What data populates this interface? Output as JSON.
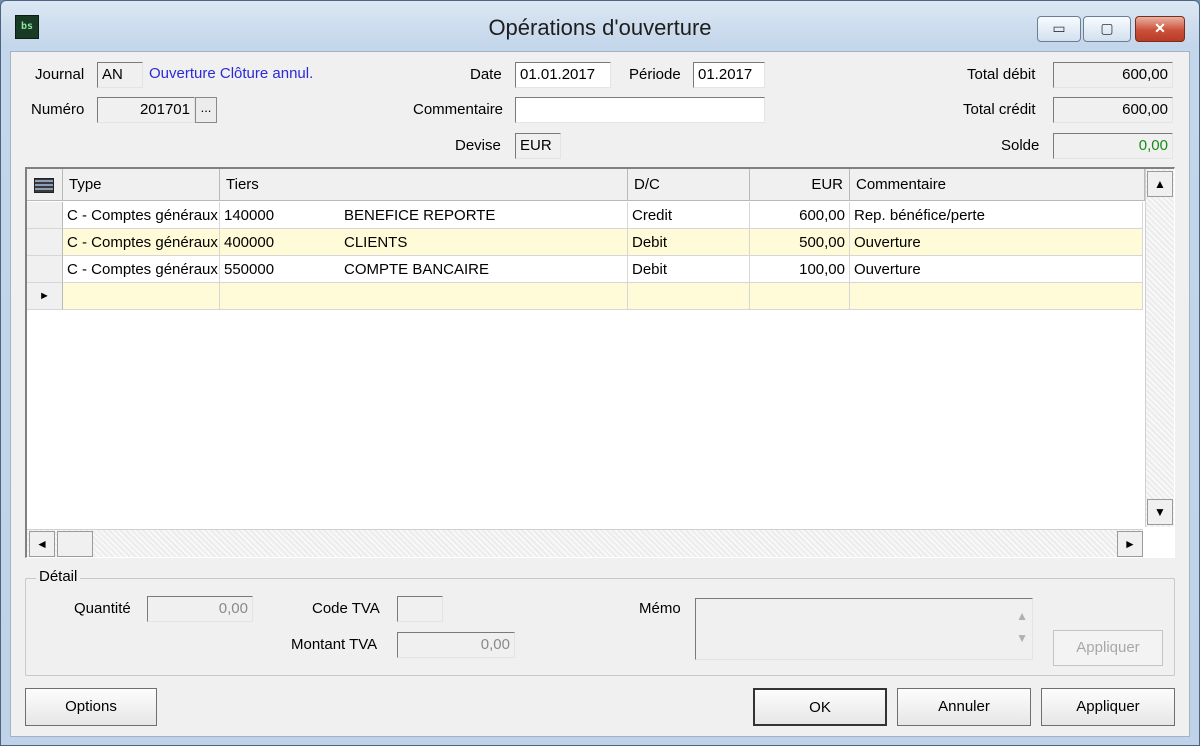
{
  "window": {
    "title": "Opérations d'ouverture",
    "icon_text": "bs",
    "controls": {
      "minimize": "▭",
      "maximize": "▢",
      "close": "✕"
    }
  },
  "header": {
    "journal_label": "Journal",
    "journal_value": "AN",
    "journal_description": "Ouverture Clôture annul.",
    "numero_label": "Numéro",
    "numero_value": "201701",
    "numero_browse": "...",
    "date_label": "Date",
    "date_value": "01.01.2017",
    "periode_label": "Période",
    "periode_value": "01.2017",
    "commentaire_label": "Commentaire",
    "commentaire_value": "",
    "devise_label": "Devise",
    "devise_value": "EUR",
    "total_debit_label": "Total débit",
    "total_debit_value": "600,00",
    "total_credit_label": "Total crédit",
    "total_credit_value": "600,00",
    "solde_label": "Solde",
    "solde_value": "0,00",
    "solde_color": "#1a8a1a"
  },
  "grid": {
    "columns": [
      "Type",
      "Tiers",
      "D/C",
      "EUR",
      "Commentaire"
    ],
    "rows": [
      {
        "type": "C - Comptes généraux",
        "tiers_code": "140000",
        "tiers_name": "BENEFICE REPORTE",
        "dc": "Credit",
        "eur": "600,00",
        "commentaire": "Rep. bénéfice/perte"
      },
      {
        "type": "C - Comptes généraux",
        "tiers_code": "400000",
        "tiers_name": "CLIENTS",
        "dc": "Debit",
        "eur": "500,00",
        "commentaire": "Ouverture"
      },
      {
        "type": "C - Comptes généraux",
        "tiers_code": "550000",
        "tiers_name": "COMPTE BANCAIRE",
        "dc": "Debit",
        "eur": "100,00",
        "commentaire": "Ouverture"
      }
    ],
    "new_row_marker": "►",
    "highlight_color": "#fffbd8",
    "scroll_up": "▲",
    "scroll_down": "▼",
    "scroll_left": "◄",
    "scroll_right": "►"
  },
  "detail": {
    "group_label": "Détail",
    "quantite_label": "Quantité",
    "quantite_value": "0,00",
    "code_tva_label": "Code TVA",
    "code_tva_value": "",
    "montant_tva_label": "Montant TVA",
    "montant_tva_value": "0,00",
    "memo_label": "Mémo",
    "memo_value": "",
    "memo_scroll_up": "▲",
    "memo_scroll_down": "▼",
    "appliquer_label": "Appliquer"
  },
  "footer": {
    "options_label": "Options",
    "ok_label": "OK",
    "annuler_label": "Annuler",
    "appliquer_label": "Appliquer"
  }
}
